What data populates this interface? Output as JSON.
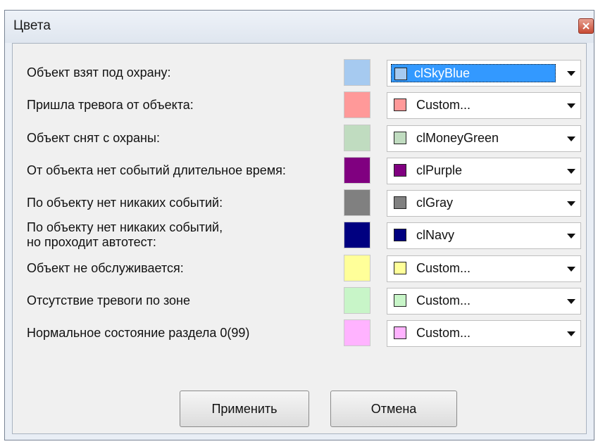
{
  "window": {
    "title": "Цвета"
  },
  "rows": [
    {
      "label": "Объект взят под охрану:",
      "color": "#a6caf0",
      "value": "clSkyBlue",
      "selected": true
    },
    {
      "label": "Пришла тревога от объекта:",
      "color": "#ff9999",
      "value": "Custom...",
      "selected": false
    },
    {
      "label": "Объект снят с охраны:",
      "color": "#c0dcc0",
      "value": "clMoneyGreen",
      "selected": false
    },
    {
      "label": "От объекта нет событий длительное время:",
      "color": "#800080",
      "value": "clPurple",
      "selected": false
    },
    {
      "label": "По объекту нет никаких событий:",
      "color": "#808080",
      "value": "clGray",
      "selected": false
    },
    {
      "label": "По объекту нет никаких событий,\nно проходит автотест:",
      "color": "#000080",
      "value": "clNavy",
      "selected": false
    },
    {
      "label": "Объект не обслуживается:",
      "color": "#ffff99",
      "value": "Custom...",
      "selected": false
    },
    {
      "label": "Отсутствие тревоги по зоне",
      "color": "#c8f5c8",
      "value": "Custom...",
      "selected": false
    },
    {
      "label": "Нормальное состояние раздела 0(99)",
      "color": "#ffb3ff",
      "value": "Custom...",
      "selected": false
    }
  ],
  "buttons": {
    "apply": "Применить",
    "cancel": "Отмена"
  }
}
